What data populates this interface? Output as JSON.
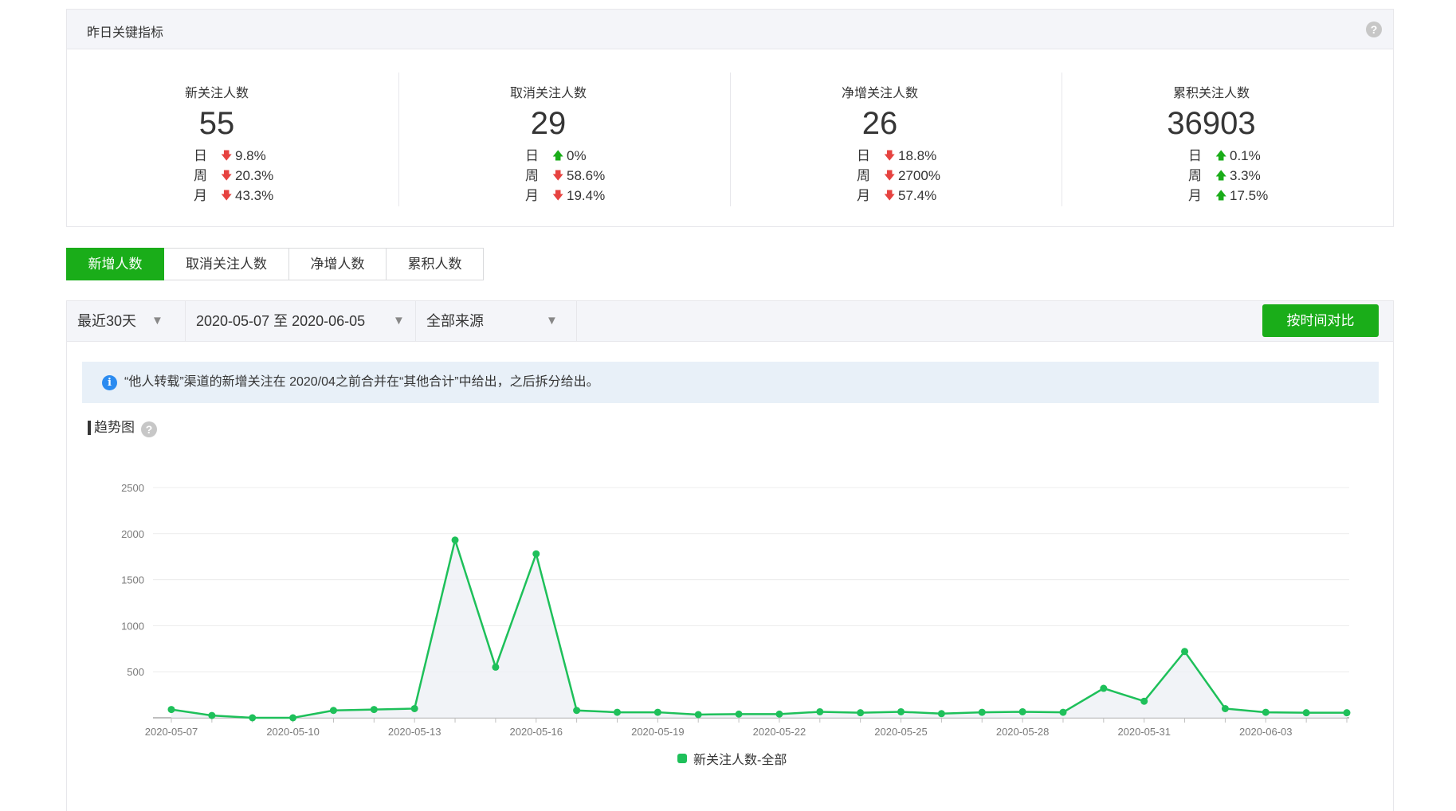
{
  "kpi": {
    "title": "昨日关键指标",
    "items": [
      {
        "name": "新关注人数",
        "value": "55",
        "rows": [
          {
            "label": "日",
            "dir": "down",
            "pct": "9.8%"
          },
          {
            "label": "周",
            "dir": "down",
            "pct": "20.3%"
          },
          {
            "label": "月",
            "dir": "down",
            "pct": "43.3%"
          }
        ]
      },
      {
        "name": "取消关注人数",
        "value": "29",
        "rows": [
          {
            "label": "日",
            "dir": "up",
            "pct": "0%"
          },
          {
            "label": "周",
            "dir": "down",
            "pct": "58.6%"
          },
          {
            "label": "月",
            "dir": "down",
            "pct": "19.4%"
          }
        ]
      },
      {
        "name": "净增关注人数",
        "value": "26",
        "rows": [
          {
            "label": "日",
            "dir": "down",
            "pct": "18.8%"
          },
          {
            "label": "周",
            "dir": "down",
            "pct": "2700%"
          },
          {
            "label": "月",
            "dir": "down",
            "pct": "57.4%"
          }
        ]
      },
      {
        "name": "累积关注人数",
        "value": "36903",
        "rows": [
          {
            "label": "日",
            "dir": "up",
            "pct": "0.1%"
          },
          {
            "label": "周",
            "dir": "up",
            "pct": "3.3%"
          },
          {
            "label": "月",
            "dir": "up",
            "pct": "17.5%"
          }
        ]
      }
    ]
  },
  "tabs": [
    "新增人数",
    "取消关注人数",
    "净增人数",
    "累积人数"
  ],
  "filters": {
    "range": "最近30天",
    "dates": "2020-05-07 至 2020-06-05",
    "source": "全部来源",
    "compare_button": "按时间对比"
  },
  "notice": "“他人转载”渠道的新增关注在 2020/04之前合并在“其他合计”中给出，之后拆分给出。",
  "trend_title": "趋势图",
  "colors": {
    "accent": "#1aad19",
    "line": "#1ec05a",
    "down": "#e64340",
    "up": "#1aad19"
  },
  "chart_data": {
    "type": "line",
    "x": [
      "2020-05-07",
      "2020-05-08",
      "2020-05-09",
      "2020-05-10",
      "2020-05-11",
      "2020-05-12",
      "2020-05-13",
      "2020-05-14",
      "2020-05-15",
      "2020-05-16",
      "2020-05-17",
      "2020-05-18",
      "2020-05-19",
      "2020-05-20",
      "2020-05-21",
      "2020-05-22",
      "2020-05-23",
      "2020-05-24",
      "2020-05-25",
      "2020-05-26",
      "2020-05-27",
      "2020-05-28",
      "2020-05-29",
      "2020-05-30",
      "2020-05-31",
      "2020-06-01",
      "2020-06-02",
      "2020-06-03",
      "2020-06-04",
      "2020-06-05"
    ],
    "x_tick_labels": [
      "2020-05-07",
      "2020-05-10",
      "2020-05-13",
      "2020-05-16",
      "2020-05-19",
      "2020-05-22",
      "2020-05-25",
      "2020-05-28",
      "2020-05-31",
      "2020-06-03"
    ],
    "series": [
      {
        "name": "新关注人数-全部",
        "values": [
          90,
          25,
          0,
          0,
          80,
          90,
          100,
          1930,
          550,
          1780,
          80,
          60,
          60,
          35,
          40,
          40,
          65,
          55,
          65,
          45,
          60,
          65,
          60,
          320,
          180,
          720,
          100,
          60,
          55,
          55
        ]
      }
    ],
    "ylim": [
      0,
      2500
    ],
    "yticks": [
      500,
      1000,
      1500,
      2000,
      2500
    ],
    "grid": true,
    "legend": "bottom"
  }
}
